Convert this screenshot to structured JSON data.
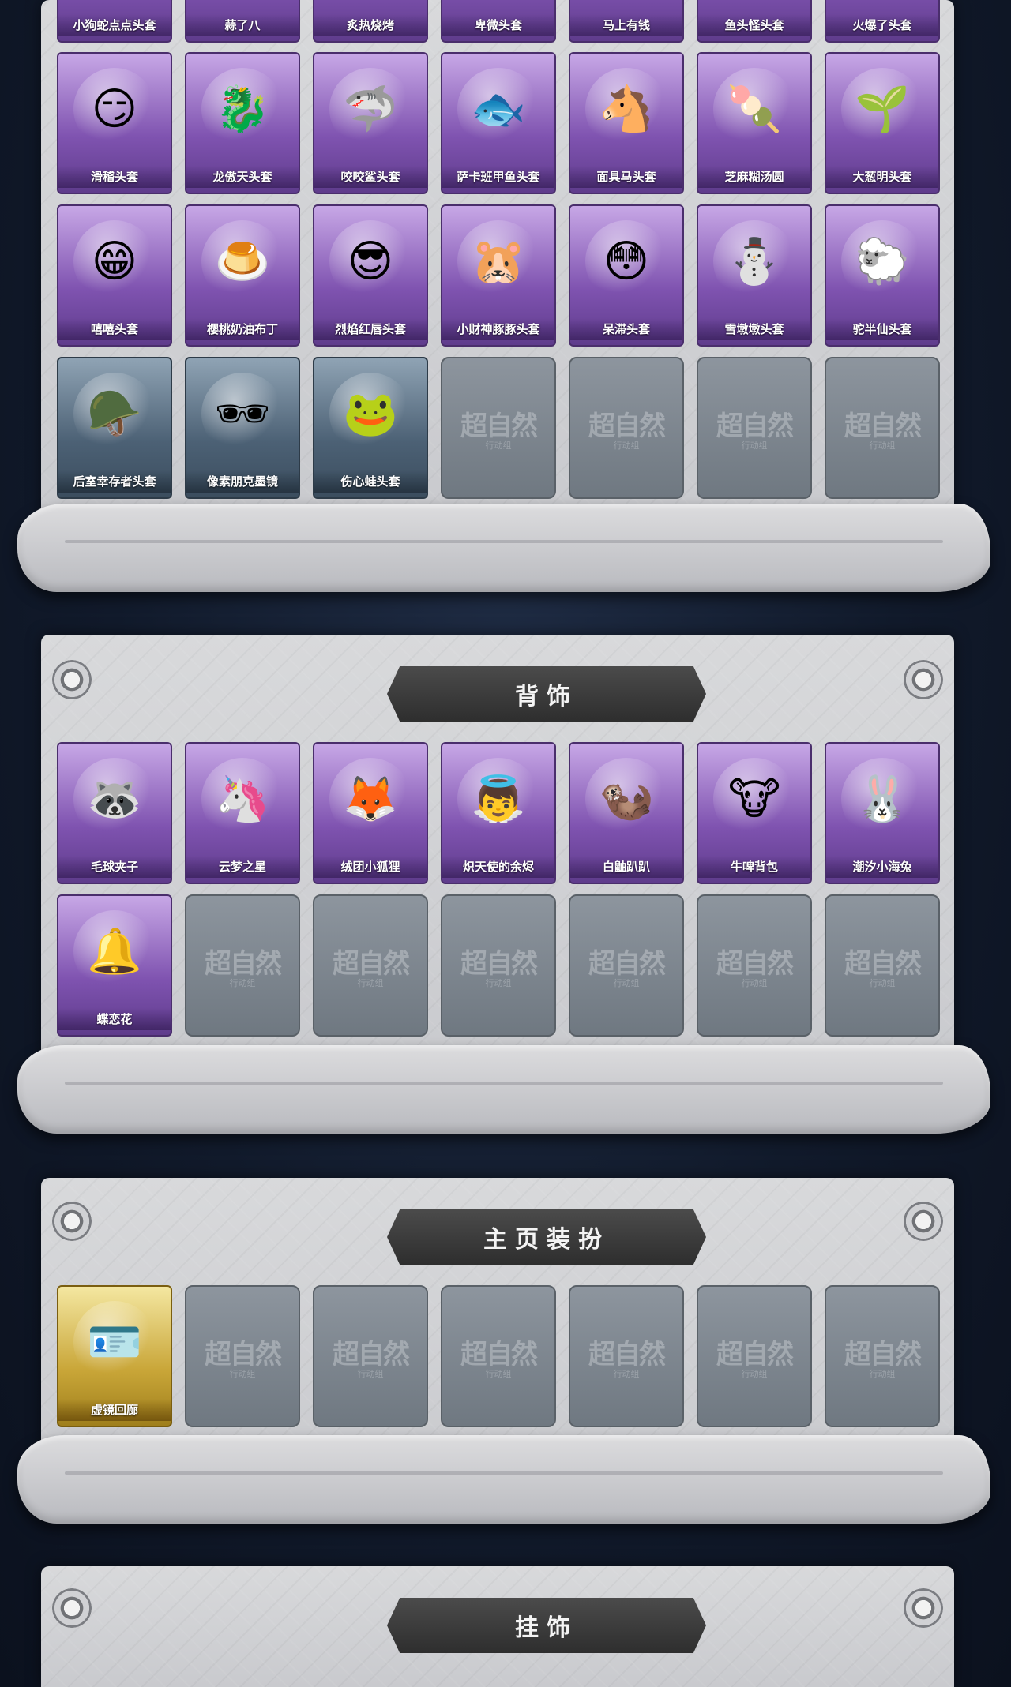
{
  "sections": [
    {
      "id": "heads",
      "rows": [
        [
          {
            "label": "小狗蛇点点头套",
            "icon": "dog-head-icon",
            "color": "purple"
          },
          {
            "label": "蒜了八",
            "icon": "garlic-head-icon",
            "color": "purple"
          },
          {
            "label": "炙热烧烤",
            "icon": "bbq-head-icon",
            "color": "purple"
          },
          {
            "label": "卑微头套",
            "icon": "humble-head-icon",
            "color": "purple"
          },
          {
            "label": "马上有钱",
            "icon": "money-head-icon",
            "color": "purple"
          },
          {
            "label": "鱼头怪头套",
            "icon": "fish-head-icon",
            "color": "purple"
          },
          {
            "label": "火爆了头套",
            "icon": "fire-head-icon",
            "color": "purple"
          }
        ],
        [
          {
            "label": "滑稽头套",
            "icon": "smirk-face-icon",
            "color": "purple",
            "glyph": "😏"
          },
          {
            "label": "龙傲天头套",
            "icon": "dragon-head-icon",
            "color": "purple",
            "glyph": "🐉"
          },
          {
            "label": "咬咬鲨头套",
            "icon": "shark-head-icon",
            "color": "purple",
            "glyph": "🦈"
          },
          {
            "label": "萨卡班甲鱼头套",
            "icon": "fish-head-icon",
            "color": "purple",
            "glyph": "🐟"
          },
          {
            "label": "面具马头套",
            "icon": "horse-head-icon",
            "color": "purple",
            "glyph": "🐴"
          },
          {
            "label": "芝麻糊汤圆",
            "icon": "dumpling-head-icon",
            "color": "purple",
            "glyph": "🍡"
          },
          {
            "label": "大葱明头套",
            "icon": "scallion-head-icon",
            "color": "purple",
            "glyph": "🌱"
          }
        ],
        [
          {
            "label": "嘻嘻头套",
            "icon": "grin-face-icon",
            "color": "purple",
            "glyph": "😁"
          },
          {
            "label": "樱桃奶油布丁",
            "icon": "pudding-head-icon",
            "color": "purple",
            "glyph": "🍮"
          },
          {
            "label": "烈焰红唇头套",
            "icon": "pikachu-head-icon",
            "color": "purple",
            "glyph": "😎"
          },
          {
            "label": "小财神豚豚头套",
            "icon": "capybara-head-icon",
            "color": "purple",
            "glyph": "🐹"
          },
          {
            "label": "呆滞头套",
            "icon": "dazed-face-icon",
            "color": "purple",
            "glyph": "😳"
          },
          {
            "label": "雪墩墩头套",
            "icon": "snowman-head-icon",
            "color": "purple",
            "glyph": "⛄"
          },
          {
            "label": "驼半仙头套",
            "icon": "alpaca-head-icon",
            "color": "purple",
            "glyph": "🐑"
          }
        ],
        [
          {
            "label": "后室幸存者头套",
            "icon": "gas-mask-icon",
            "color": "blue",
            "glyph": "🪖"
          },
          {
            "label": "像素朋克墨镜",
            "icon": "pixel-sunglasses-icon",
            "color": "blue",
            "glyph": "🕶"
          },
          {
            "label": "伤心蛙头套",
            "icon": "frog-head-icon",
            "color": "blue",
            "glyph": "🐸"
          },
          {
            "label": "",
            "icon": "placeholder-icon",
            "color": "empty"
          },
          {
            "label": "",
            "icon": "placeholder-icon",
            "color": "empty"
          },
          {
            "label": "",
            "icon": "placeholder-icon",
            "color": "empty"
          },
          {
            "label": "",
            "icon": "placeholder-icon",
            "color": "empty"
          }
        ]
      ]
    },
    {
      "id": "back",
      "title": "背饰",
      "rows": [
        [
          {
            "label": "毛球夹子",
            "icon": "red-panda-drum-icon",
            "color": "purple",
            "glyph": "🦝"
          },
          {
            "label": "云梦之星",
            "icon": "unicorn-icon",
            "color": "purple",
            "glyph": "🦄"
          },
          {
            "label": "绒团小狐狸",
            "icon": "fox-icon",
            "color": "purple",
            "glyph": "🦊"
          },
          {
            "label": "炽天使的余烬",
            "icon": "angel-doll-icon",
            "color": "purple",
            "glyph": "👼"
          },
          {
            "label": "白鼬趴趴",
            "icon": "ermine-icon",
            "color": "purple",
            "glyph": "🦦"
          },
          {
            "label": "牛啤背包",
            "icon": "cow-beer-icon",
            "color": "purple",
            "glyph": "🐮"
          },
          {
            "label": "潮汐小海兔",
            "icon": "sea-bunny-icon",
            "color": "purple",
            "glyph": "🐰"
          }
        ],
        [
          {
            "label": "蝶恋花",
            "icon": "bell-flower-icon",
            "color": "purple",
            "glyph": "🔔"
          },
          {
            "label": "",
            "icon": "placeholder-icon",
            "color": "empty"
          },
          {
            "label": "",
            "icon": "placeholder-icon",
            "color": "empty"
          },
          {
            "label": "",
            "icon": "placeholder-icon",
            "color": "empty"
          },
          {
            "label": "",
            "icon": "placeholder-icon",
            "color": "empty"
          },
          {
            "label": "",
            "icon": "placeholder-icon",
            "color": "empty"
          },
          {
            "label": "",
            "icon": "placeholder-icon",
            "color": "empty"
          }
        ]
      ]
    },
    {
      "id": "home",
      "title": "主页装扮",
      "rows": [
        [
          {
            "label": "虚镜回廊",
            "icon": "profile-card-icon",
            "color": "gold",
            "glyph": "🪪"
          },
          {
            "label": "",
            "icon": "placeholder-icon",
            "color": "empty"
          },
          {
            "label": "",
            "icon": "placeholder-icon",
            "color": "empty"
          },
          {
            "label": "",
            "icon": "placeholder-icon",
            "color": "empty"
          },
          {
            "label": "",
            "icon": "placeholder-icon",
            "color": "empty"
          },
          {
            "label": "",
            "icon": "placeholder-icon",
            "color": "empty"
          },
          {
            "label": "",
            "icon": "placeholder-icon",
            "color": "empty"
          }
        ]
      ]
    },
    {
      "id": "pendant",
      "title": "挂饰",
      "rows": []
    }
  ],
  "watermark": {
    "main": "超自然",
    "sub": "行动组"
  },
  "colors": {
    "purple": "#8a5cc0",
    "blue": "#4c6175",
    "gold": "#c9a638",
    "empty": "#7a838c",
    "banner": "#3a3a3a"
  }
}
